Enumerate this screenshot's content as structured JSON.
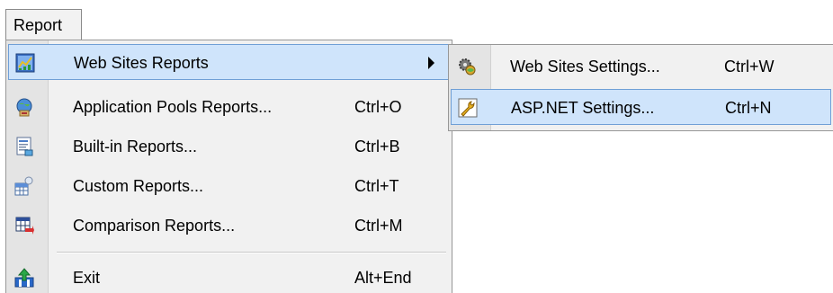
{
  "menubar": {
    "report_label": "Report"
  },
  "main_menu": {
    "items": [
      {
        "label": "Web Sites Reports",
        "shortcut": "",
        "icon": "web-sites-reports-icon",
        "has_submenu": true,
        "highlighted": true
      },
      {
        "label": "Application Pools Reports...",
        "shortcut": "Ctrl+O",
        "icon": "application-pools-icon"
      },
      {
        "label": "Built-in Reports...",
        "shortcut": "Ctrl+B",
        "icon": "built-in-reports-icon"
      },
      {
        "label": "Custom Reports...",
        "shortcut": "Ctrl+T",
        "icon": "custom-reports-icon"
      },
      {
        "label": "Comparison Reports...",
        "shortcut": "Ctrl+M",
        "icon": "comparison-reports-icon"
      },
      {
        "label": "Exit",
        "shortcut": "Alt+End",
        "icon": "exit-icon"
      }
    ]
  },
  "sub_menu": {
    "items": [
      {
        "label": "Web Sites Settings...",
        "shortcut": "Ctrl+W",
        "icon": "web-sites-settings-icon"
      },
      {
        "label": "ASP.NET Settings...",
        "shortcut": "Ctrl+N",
        "icon": "aspnet-settings-icon",
        "highlighted": true
      }
    ]
  },
  "colors": {
    "highlight_bg": "#cfe4fb",
    "highlight_border": "#6f9fd6",
    "menu_bg": "#f1f1f1",
    "gutter_bg": "#e4e4e4"
  }
}
